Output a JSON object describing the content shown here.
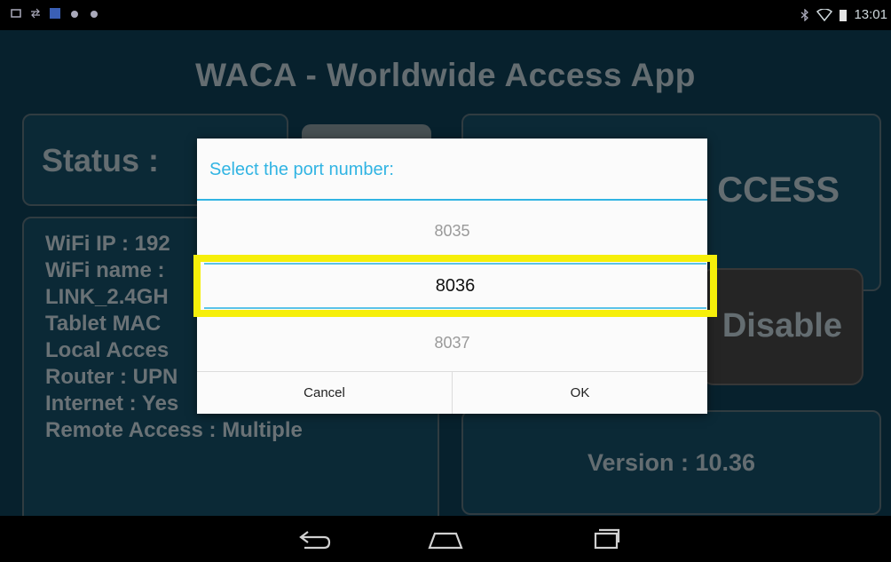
{
  "status_bar": {
    "time": "13:01"
  },
  "app": {
    "title": "WACA - Worldwide Access App",
    "status_label": "Status :",
    "info_lines": [
      "WiFi IP : 192",
      "WiFi name :",
      "LINK_2.4GH",
      "Tablet MAC",
      "Local Acces",
      "Router : UPN",
      "Internet : Yes",
      "Remote Access : Multiple"
    ],
    "access_label": "CCESS",
    "disable_label": "Disable",
    "version": "Version : 10.36"
  },
  "dialog": {
    "title": "Select the port number:",
    "picker": {
      "previous": "8035",
      "selected": "8036",
      "next": "8037"
    },
    "cancel_label": "Cancel",
    "ok_label": "OK"
  },
  "colors": {
    "accent": "#31b4e3",
    "highlight": "#f6ef0a",
    "app_bg": "#0b3346"
  }
}
